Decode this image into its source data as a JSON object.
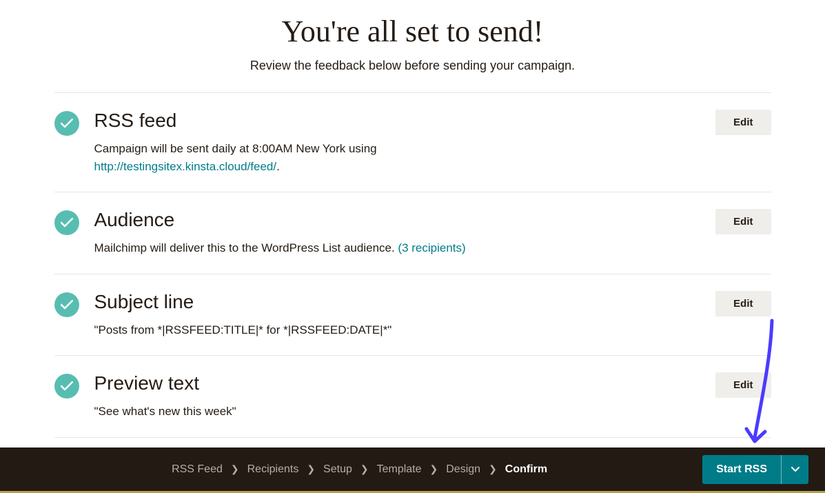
{
  "header": {
    "title": "You're all set to send!",
    "subtitle": "Review the feedback below before sending your campaign."
  },
  "sections": [
    {
      "title": "RSS feed",
      "desc_prefix": "Campaign will be sent daily at 8:00AM New York using ",
      "link_text": "http://testingsitex.kinsta.cloud/feed/",
      "desc_suffix": ".",
      "edit_label": "Edit"
    },
    {
      "title": "Audience",
      "desc_prefix": "Mailchimp will deliver this to the WordPress List audience. ",
      "link_text": "(3 recipients)",
      "desc_suffix": "",
      "edit_label": "Edit"
    },
    {
      "title": "Subject line",
      "desc_prefix": "\"Posts from *|RSSFEED:TITLE|* for *|RSSFEED:DATE|*\"",
      "link_text": "",
      "desc_suffix": "",
      "edit_label": "Edit"
    },
    {
      "title": "Preview text",
      "desc_prefix": "\"See what's new this week\"",
      "link_text": "",
      "desc_suffix": "",
      "edit_label": "Edit"
    }
  ],
  "breadcrumb": {
    "items": [
      "RSS Feed",
      "Recipients",
      "Setup",
      "Template",
      "Design",
      "Confirm"
    ],
    "active_index": 5
  },
  "footer": {
    "start_label": "Start RSS"
  }
}
